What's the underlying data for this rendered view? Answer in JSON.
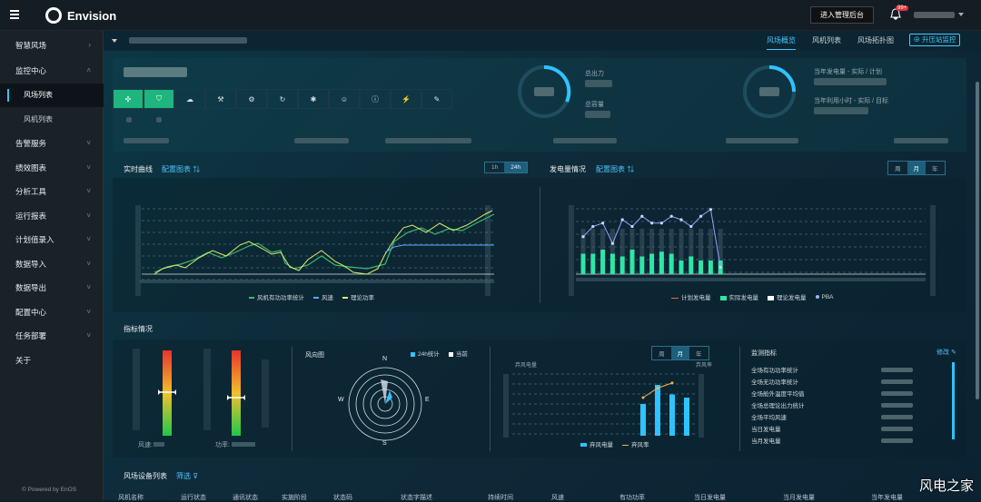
{
  "app": {
    "brand": "Envision"
  },
  "topbar": {
    "admin_button": "进入管理后台",
    "notification_badge": "99+"
  },
  "sidebar": {
    "items": [
      {
        "label": "智慧风场",
        "type": "head",
        "chev": ">"
      },
      {
        "label": "监控中心",
        "type": "head",
        "chev": "^"
      },
      {
        "label": "风场列表",
        "type": "sub",
        "active": true
      },
      {
        "label": "风机列表",
        "type": "sub"
      },
      {
        "label": "告警服务",
        "type": "head",
        "chev": "v"
      },
      {
        "label": "绩效图表",
        "type": "head",
        "chev": "v"
      },
      {
        "label": "分析工具",
        "type": "head",
        "chev": "v"
      },
      {
        "label": "运行报表",
        "type": "head",
        "chev": "v"
      },
      {
        "label": "计划值录入",
        "type": "head",
        "chev": "v"
      },
      {
        "label": "数据导入",
        "type": "head",
        "chev": "v"
      },
      {
        "label": "数据导出",
        "type": "head",
        "chev": "v"
      },
      {
        "label": "配置中心",
        "type": "head",
        "chev": "v"
      },
      {
        "label": "任务部署",
        "type": "head",
        "chev": "v"
      },
      {
        "label": "关于",
        "type": "head"
      }
    ],
    "powered_by": "© Powered by EnOS"
  },
  "subnav": {
    "tabs": [
      "风场概览",
      "风机列表",
      "风场拓扑图"
    ],
    "active_tab": "风场概览",
    "boost_button": "升压站监控"
  },
  "overview": {
    "metrics_left": {
      "label1": "总出力",
      "label2": "总容量"
    },
    "metrics_right": {
      "label1": "当年发电量 - 实际 / 计划",
      "label2": "当年利用小时 - 实际 / 目标"
    }
  },
  "realtime": {
    "title": "实时曲线",
    "config_link": "配置图表",
    "segments": [
      "1h",
      "24h"
    ],
    "active_segment": "24h",
    "legend": [
      "风机有功功率统计",
      "风速",
      "理论功率"
    ]
  },
  "generation": {
    "title": "发电量情况",
    "config_link": "配置图表",
    "segments": [
      "周",
      "月",
      "年"
    ],
    "active_segment": "月",
    "legend": [
      "计划发电量",
      "实际发电量",
      "理论发电量",
      "PBA"
    ]
  },
  "indicators": {
    "title": "指标情况",
    "gauge1_label": "风速:",
    "gauge2_label": "功率:",
    "rose_title": "风向图",
    "rose_legend": [
      "24h统计",
      "当前"
    ],
    "compass": [
      "N",
      "E",
      "S",
      "W"
    ],
    "abandon_segments": [
      "周",
      "月",
      "年"
    ],
    "abandon_active": "月",
    "abandon_axis_left": "弃风电量",
    "abandon_axis_right": "弃风率",
    "abandon_legend": [
      "弃风电量",
      "弃风率"
    ],
    "monitor_title": "监测指标",
    "monitor_edit": "修改",
    "monitor_items": [
      "全场有功功率统计",
      "全场无功功率统计",
      "全场舱外温度平均值",
      "全场总理论出力统计",
      "全场平均风速",
      "当日发电量",
      "当月发电量"
    ]
  },
  "device_table": {
    "title": "风场设备列表",
    "filter": "筛选",
    "columns": [
      "风机名称",
      "运行状态",
      "通讯状态",
      "实施阶段",
      "状态码",
      "状态字描述",
      "持续时间",
      "风速",
      "有功功率",
      "当日发电量",
      "当月发电量",
      "当年发电量"
    ]
  },
  "chart_data": [
    {
      "type": "line",
      "title": "实时曲线",
      "series": [
        {
          "name": "风机有功功率统计"
        },
        {
          "name": "风速"
        },
        {
          "name": "理论功率"
        }
      ],
      "grid": true,
      "legend": "bottom"
    },
    {
      "type": "bar",
      "title": "发电量情况",
      "series": [
        {
          "name": "计划发电量"
        },
        {
          "name": "实际发电量",
          "values": [
            3,
            3,
            3.6,
            3,
            2.6,
            3.6,
            2.6,
            3,
            3.3,
            3,
            2,
            2.6,
            2,
            2,
            2
          ]
        },
        {
          "name": "理论发电量"
        },
        {
          "name": "PBA",
          "values": [
            5.5,
            7,
            7.5,
            4.5,
            8,
            7,
            8.5,
            7.5,
            7.5,
            8.5,
            8,
            7,
            8.5,
            9.5,
            1
          ]
        }
      ],
      "legend": "bottom"
    },
    {
      "type": "bar",
      "title": "弃风电量",
      "series": [
        {
          "name": "弃风电量",
          "values": [
            5,
            8,
            6.5,
            6
          ]
        },
        {
          "name": "弃风率",
          "values": [
            6,
            7.5,
            8.3
          ]
        }
      ],
      "legend": "bottom"
    }
  ],
  "watermark": "风电之家",
  "colors": {
    "accent": "#4cc6ff",
    "green": "#1fb57e",
    "bar": "#2ee6a8",
    "line_yellow": "#d9ef6a",
    "line_blue": "#5aa8ff"
  }
}
